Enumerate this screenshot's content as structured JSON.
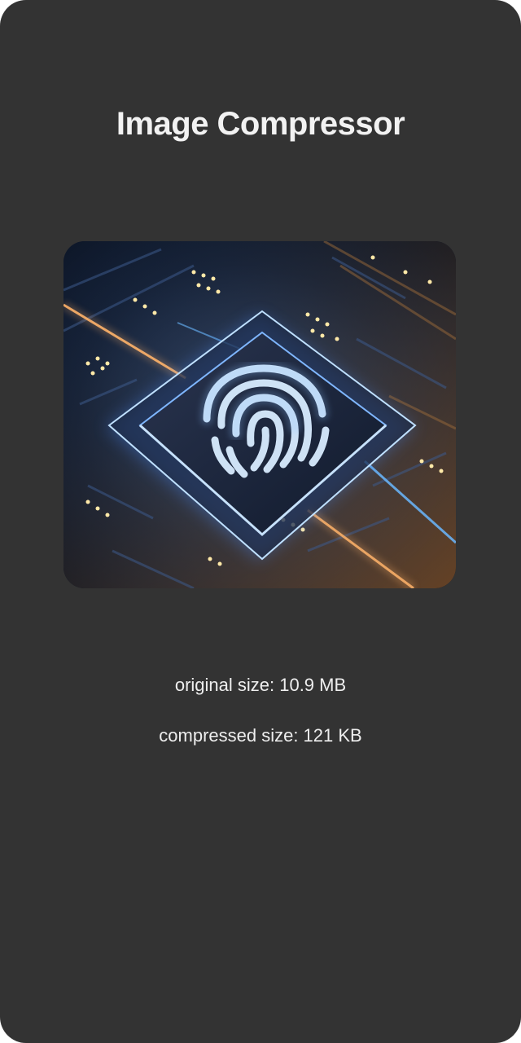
{
  "app": {
    "title": "Image Compressor",
    "background_color": "#333333",
    "text_color": "#f2f2f2"
  },
  "preview": {
    "icon": "fingerprint-chip-image"
  },
  "stats": {
    "original_label": "original size: 10.9 MB",
    "compressed_label": "compressed size: 121 KB"
  }
}
